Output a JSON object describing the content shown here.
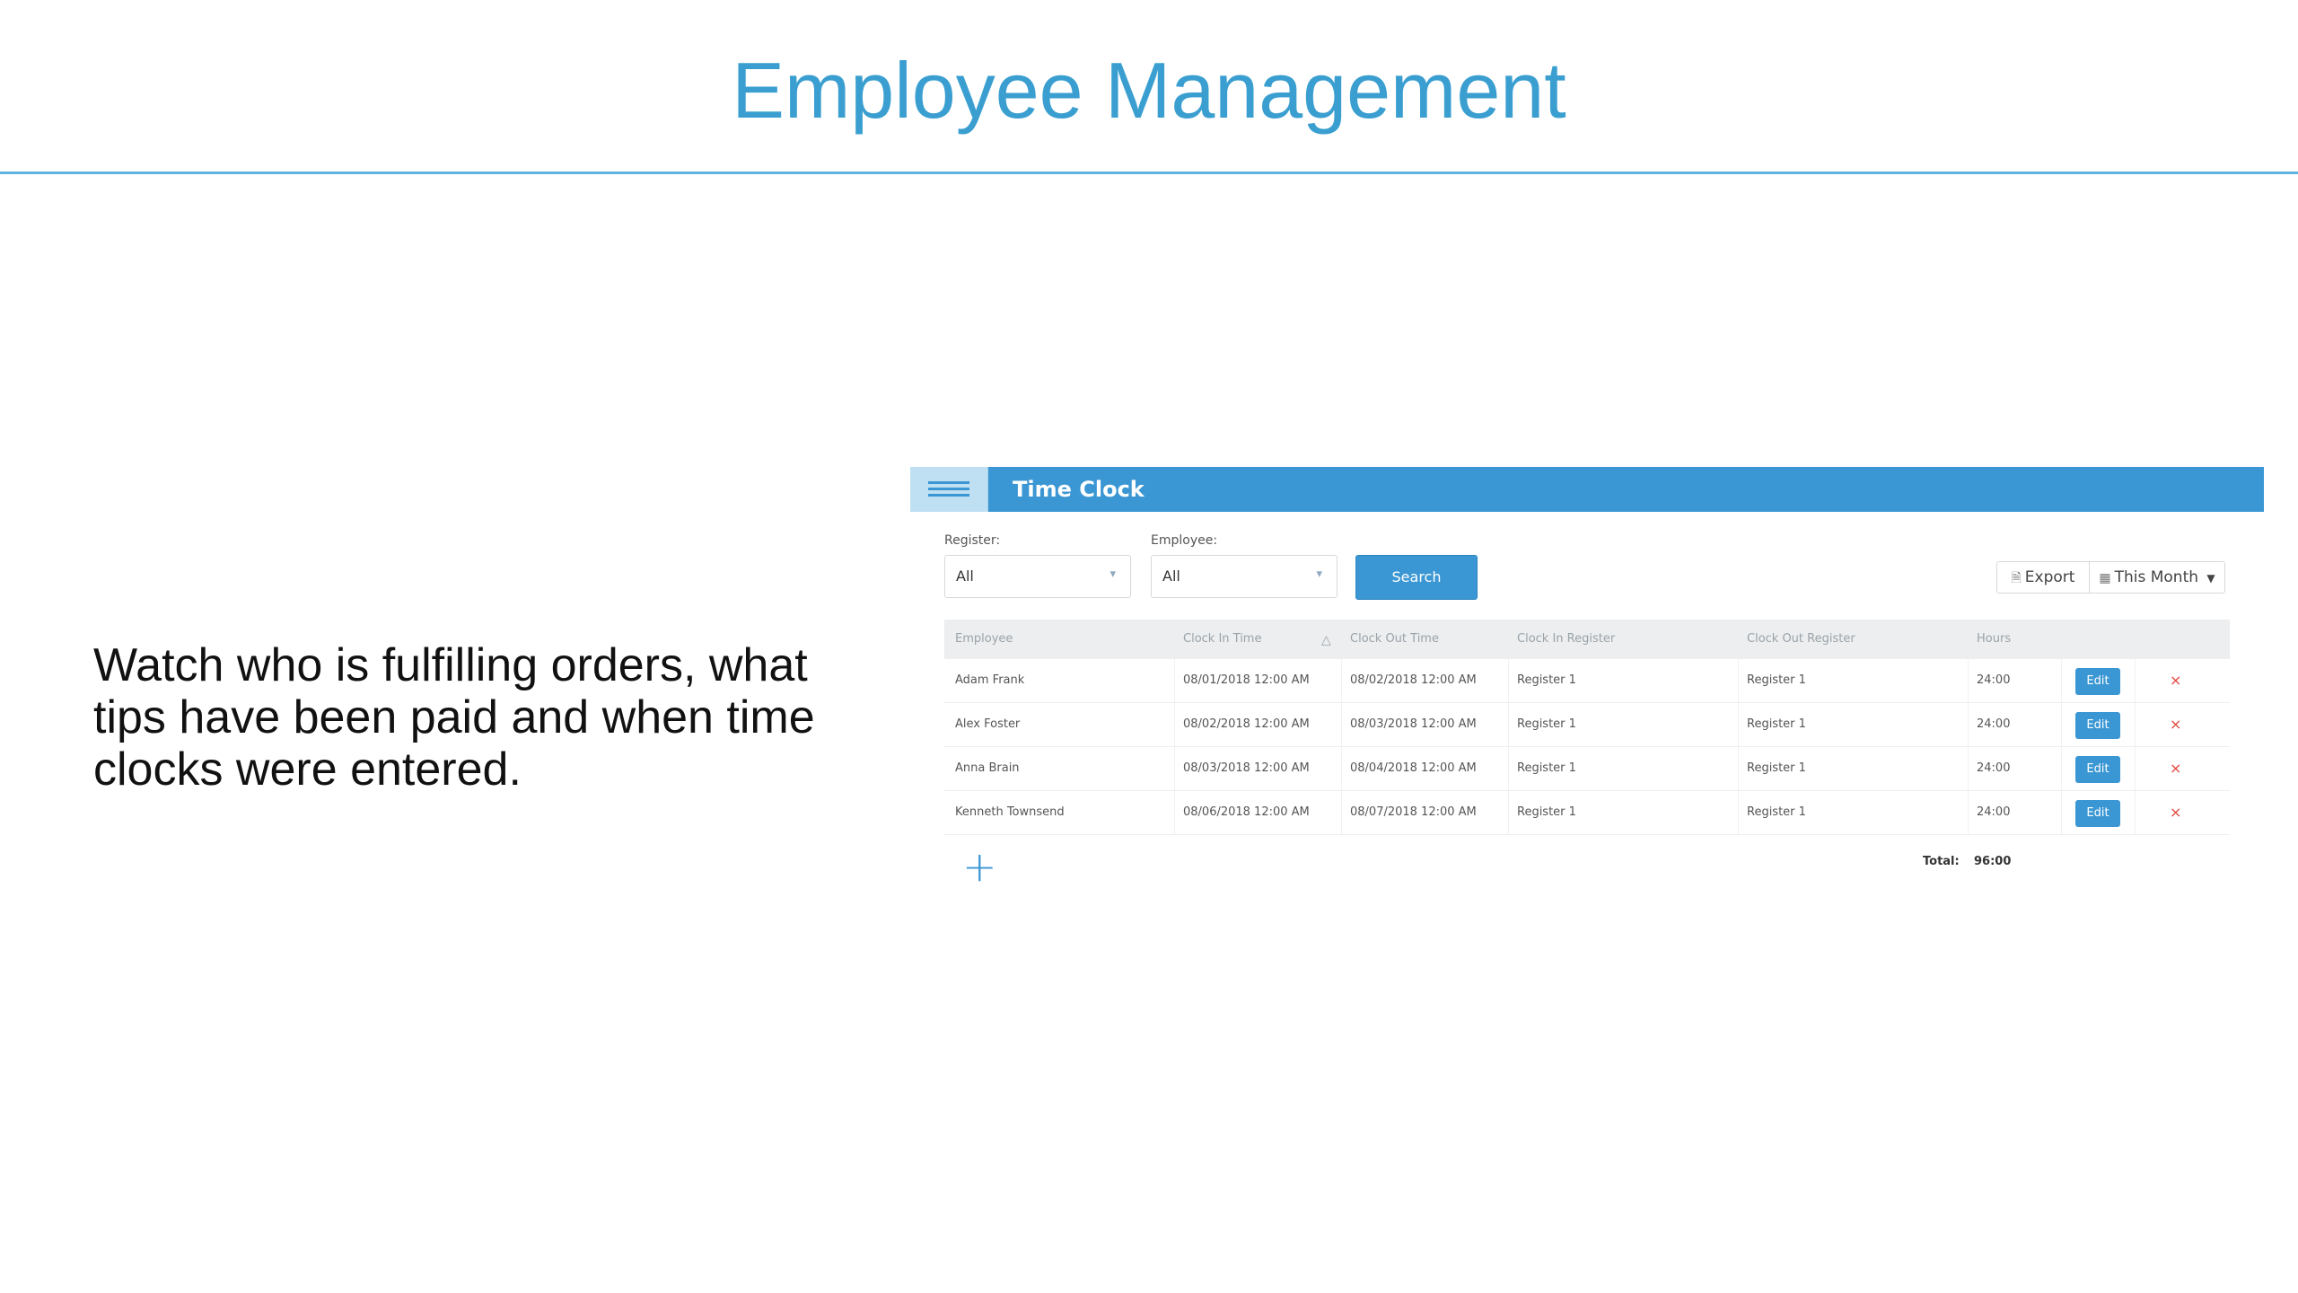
{
  "slide": {
    "title": "Employee Management",
    "body": "Watch who is fulfilling orders, what tips have been paid and when time clocks were entered."
  },
  "app": {
    "panel_title": "Time Clock",
    "menu_icon": "hamburger-icon",
    "filters": {
      "register_label": "Register:",
      "register_value": "All",
      "employee_label": "Employee:",
      "employee_value": "All",
      "search_label": "Search"
    },
    "toolbar": {
      "export_label": "Export",
      "export_icon": "document-icon",
      "range_label": "This Month",
      "range_icon": "calendar-icon"
    },
    "table": {
      "headers": [
        "Employee",
        "Clock In Time",
        "Clock Out Time",
        "Clock In Register",
        "Clock Out Register",
        "Hours"
      ],
      "rows": [
        {
          "employee": "Adam Frank",
          "clock_in": "08/01/2018 12:00 AM",
          "clock_out": "08/02/2018 12:00 AM",
          "in_register": "Register 1",
          "out_register": "Register 1",
          "hours": "24:00",
          "edit": "Edit",
          "delete": "×"
        },
        {
          "employee": "Alex Foster",
          "clock_in": "08/02/2018 12:00 AM",
          "clock_out": "08/03/2018 12:00 AM",
          "in_register": "Register 1",
          "out_register": "Register 1",
          "hours": "24:00",
          "edit": "Edit",
          "delete": "×"
        },
        {
          "employee": "Anna Brain",
          "clock_in": "08/03/2018 12:00 AM",
          "clock_out": "08/04/2018 12:00 AM",
          "in_register": "Register 1",
          "out_register": "Register 1",
          "hours": "24:00",
          "edit": "Edit",
          "delete": "×"
        },
        {
          "employee": "Kenneth Townsend",
          "clock_in": "08/06/2018 12:00 AM",
          "clock_out": "08/07/2018 12:00 AM",
          "in_register": "Register 1",
          "out_register": "Register 1",
          "hours": "24:00",
          "edit": "Edit",
          "delete": "×"
        }
      ]
    },
    "footer": {
      "add_symbol": "+",
      "total_label": "Total:",
      "total_value": "96:00"
    },
    "colors": {
      "accent": "#3b97d3",
      "title": "#3a9fd0",
      "delete": "#e2463f"
    }
  }
}
